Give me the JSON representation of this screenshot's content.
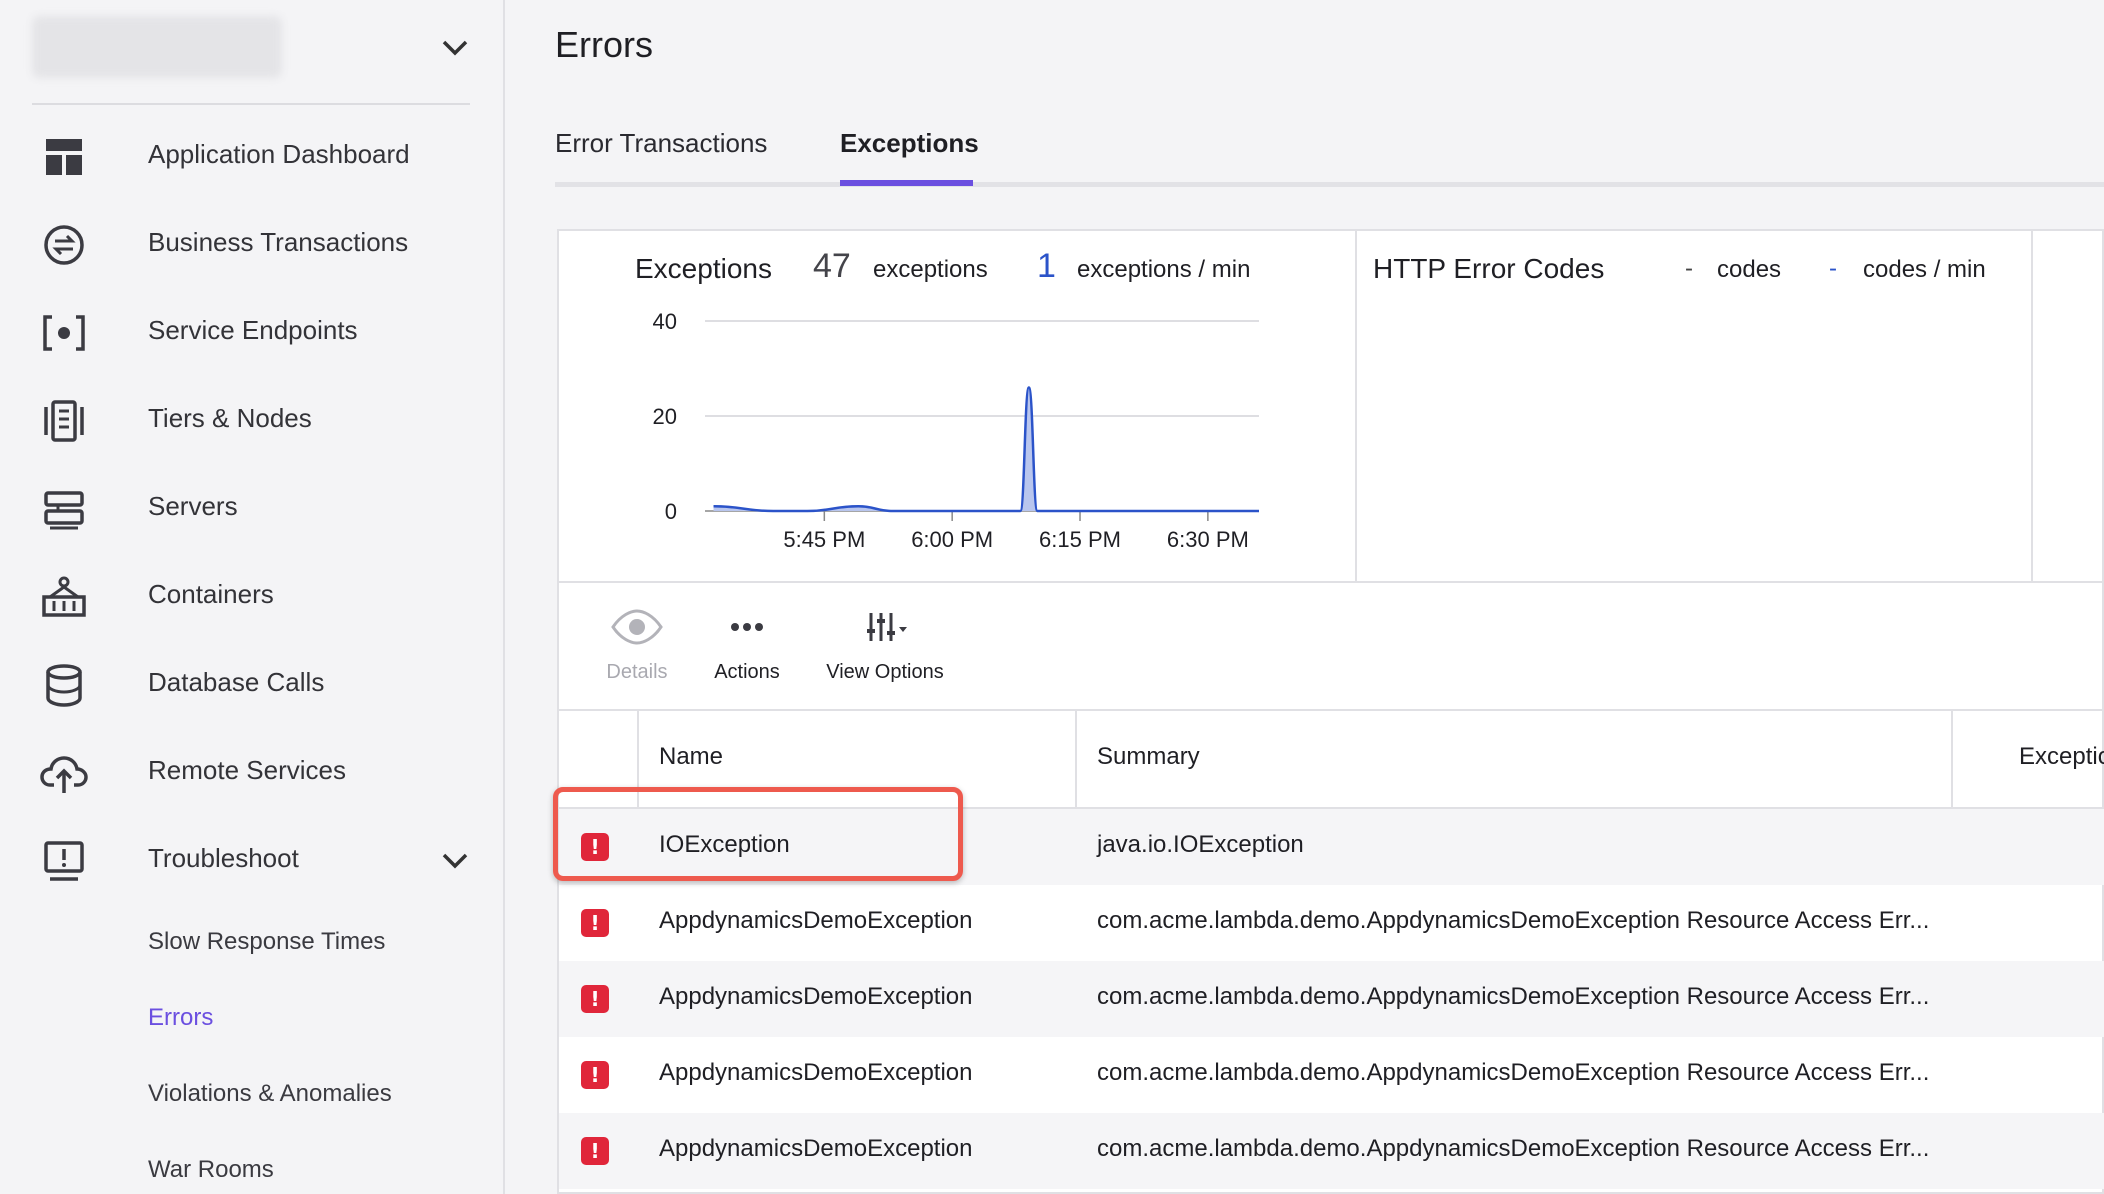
{
  "sidebar": {
    "items": [
      {
        "label": "Application Dashboard",
        "icon": "dashboard-icon"
      },
      {
        "label": "Business Transactions",
        "icon": "transactions-icon"
      },
      {
        "label": "Service Endpoints",
        "icon": "endpoint-icon"
      },
      {
        "label": "Tiers & Nodes",
        "icon": "tiers-icon"
      },
      {
        "label": "Servers",
        "icon": "servers-icon"
      },
      {
        "label": "Containers",
        "icon": "containers-icon"
      },
      {
        "label": "Database Calls",
        "icon": "database-icon"
      },
      {
        "label": "Remote Services",
        "icon": "cloud-upload-icon"
      },
      {
        "label": "Troubleshoot",
        "icon": "troubleshoot-icon"
      }
    ],
    "troubleshoot_children": [
      {
        "label": "Slow Response Times"
      },
      {
        "label": "Errors"
      },
      {
        "label": "Violations & Anomalies"
      },
      {
        "label": "War Rooms"
      }
    ]
  },
  "page": {
    "title": "Errors"
  },
  "tabs": [
    {
      "label": "Error Transactions"
    },
    {
      "label": "Exceptions"
    }
  ],
  "exceptions_widget": {
    "title": "Exceptions",
    "count": "47",
    "count_unit": "exceptions",
    "rate": "1",
    "rate_unit": "exceptions / min"
  },
  "http_widget": {
    "title": "HTTP Error Codes",
    "count": "-",
    "count_unit": "codes",
    "rate": "-",
    "rate_unit": "codes / min"
  },
  "chart_data": {
    "type": "area",
    "title": "",
    "xlabel": "",
    "ylabel": "",
    "x_tick_labels": [
      "5:45 PM",
      "6:00 PM",
      "6:15 PM",
      "6:30 PM"
    ],
    "y_tick_labels": [
      "40",
      "20",
      "0"
    ],
    "ylim": [
      0,
      40
    ],
    "grid": true,
    "series_color": "#2b53c9",
    "x_minutes": [
      5.32,
      5.5,
      5.6,
      5.75,
      5.85,
      6.0,
      6.05,
      6.1,
      6.14,
      6.17,
      6.2,
      6.23,
      6.26,
      6.32,
      6.5
    ],
    "x": [
      "5:32 PM",
      "5:39 PM",
      "5:43 PM",
      "5:49 PM",
      "5:53 PM",
      "6:00 PM",
      "6:02 PM",
      "6:04 PM",
      "6:05 PM",
      "6:07 PM",
      "6:08 PM",
      "6:09 PM",
      "6:10 PM",
      "6:13 PM",
      "6:20 PM",
      "6:36 PM"
    ],
    "values": [
      1,
      0,
      0,
      1,
      0,
      0,
      0,
      0,
      0,
      0,
      0,
      26,
      0,
      0,
      0,
      0
    ]
  },
  "toolbar": {
    "details": "Details",
    "actions": "Actions",
    "view_options": "View Options"
  },
  "table": {
    "columns": [
      "Name",
      "Summary",
      "Exceptio"
    ],
    "rows": [
      {
        "name": "IOException",
        "summary": "java.io.IOException"
      },
      {
        "name": "AppdynamicsDemoException",
        "summary": "com.acme.lambda.demo.AppdynamicsDemoException Resource Access Err..."
      },
      {
        "name": "AppdynamicsDemoException",
        "summary": "com.acme.lambda.demo.AppdynamicsDemoException Resource Access Err..."
      },
      {
        "name": "AppdynamicsDemoException",
        "summary": "com.acme.lambda.demo.AppdynamicsDemoException Resource Access Err..."
      },
      {
        "name": "AppdynamicsDemoException",
        "summary": "com.acme.lambda.demo.AppdynamicsDemoException Resource Access Err..."
      }
    ]
  }
}
